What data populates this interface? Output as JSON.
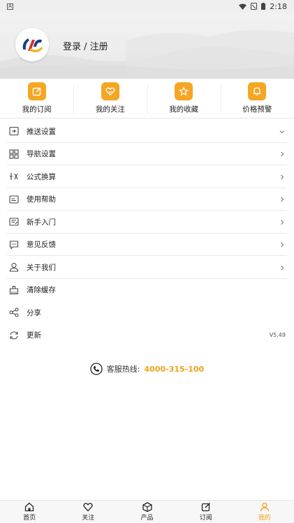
{
  "status_bar": {
    "left_icon": "notification-a-icon",
    "time": "2:18"
  },
  "header": {
    "login_text": "登录 / 注册"
  },
  "quick_actions": [
    {
      "label": "我的订阅",
      "icon": "edit-icon"
    },
    {
      "label": "我的关注",
      "icon": "heart-icon"
    },
    {
      "label": "我的收藏",
      "icon": "star-icon"
    },
    {
      "label": "价格预警",
      "icon": "bell-icon"
    }
  ],
  "menu": [
    {
      "label": "推送设置",
      "icon": "push-icon",
      "right": "chevron-down"
    },
    {
      "label": "导航设置",
      "icon": "grid-icon",
      "right": "chevron-right"
    },
    {
      "label": "公式换算",
      "icon": "formula-icon",
      "right": "chevron-right"
    },
    {
      "label": "使用帮助",
      "icon": "help-icon",
      "right": "chevron-right"
    },
    {
      "label": "新手入门",
      "icon": "guide-icon",
      "right": "chevron-right"
    },
    {
      "label": "意见反馈",
      "icon": "feedback-icon",
      "right": "chevron-right"
    },
    {
      "label": "关于我们",
      "icon": "user-icon",
      "right": "chevron-right"
    },
    {
      "label": "清除缓存",
      "icon": "clear-icon",
      "right": ""
    },
    {
      "label": "分享",
      "icon": "share-icon",
      "right": ""
    },
    {
      "label": "更新",
      "icon": "refresh-icon",
      "right": "",
      "version": "V5.49"
    }
  ],
  "hotline": {
    "label": "客服热线:",
    "number": "4000-315-100"
  },
  "tabbar": [
    {
      "label": "首页",
      "icon": "home-icon"
    },
    {
      "label": "关注",
      "icon": "heart-icon"
    },
    {
      "label": "产品",
      "icon": "box-icon"
    },
    {
      "label": "订阅",
      "icon": "edit-icon"
    },
    {
      "label": "我的",
      "icon": "person-icon",
      "active": true
    }
  ],
  "colors": {
    "accent": "#f5a623",
    "accent_text": "#f0a21c"
  }
}
